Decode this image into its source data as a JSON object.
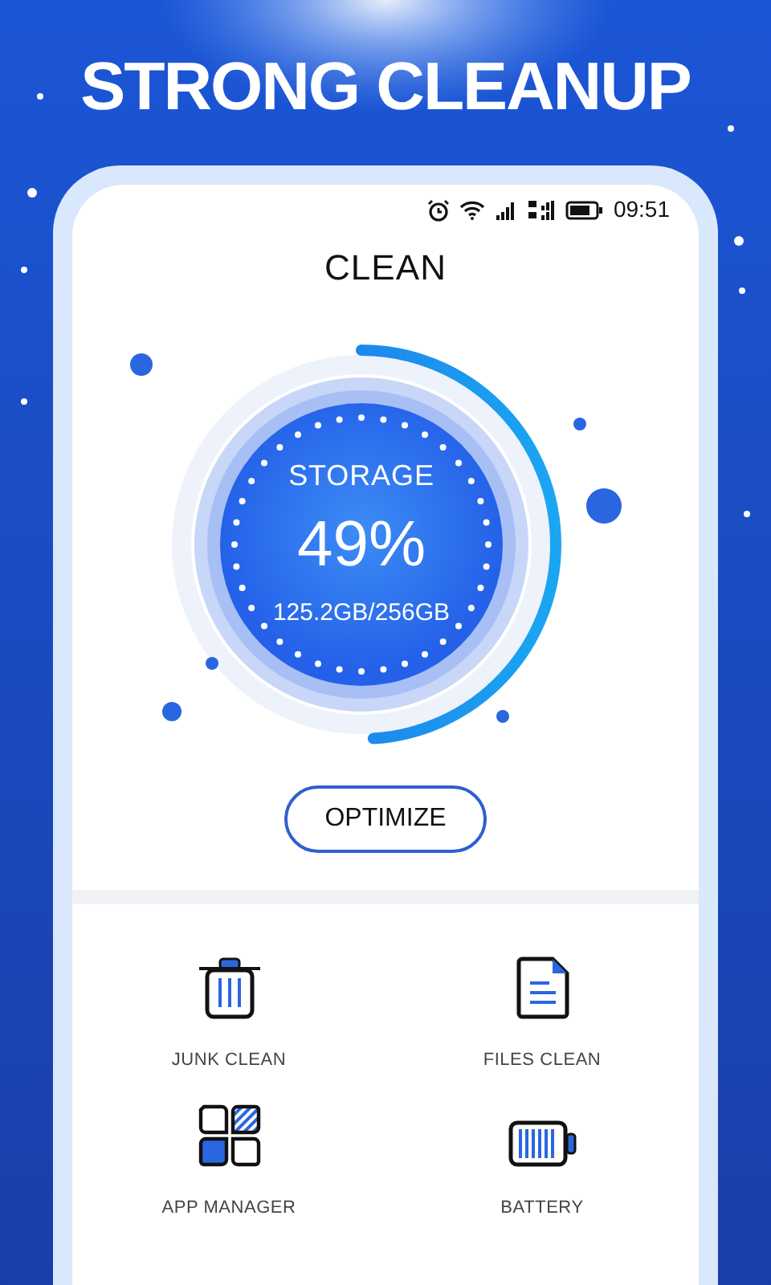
{
  "headline": "STRONG CLEANUP",
  "status_bar": {
    "time": "09:51"
  },
  "screen_title": "CLEAN",
  "storage": {
    "label": "STORAGE",
    "percent": "49%",
    "usage": "125.2GB/256GB",
    "level": 0.49
  },
  "optimize_button": "OPTIMIZE",
  "tools": [
    {
      "label": "JUNK CLEAN",
      "kind": "trash"
    },
    {
      "label": "FILES CLEAN",
      "kind": "file"
    },
    {
      "label": "APP MANAGER",
      "kind": "apps"
    },
    {
      "label": "BATTERY",
      "kind": "battery"
    }
  ]
}
